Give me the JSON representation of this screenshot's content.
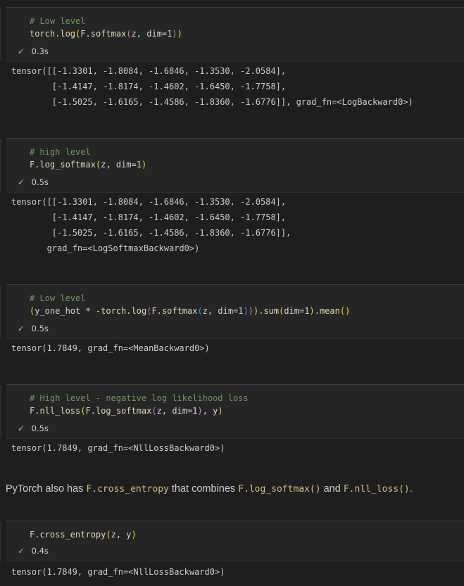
{
  "cells": [
    {
      "comment": "# Low level",
      "code_line": "torch.log(F.softmax(z, dim=1))",
      "status": "0.3s",
      "output": [
        "tensor([[-1.3301, -1.8084, -1.6846, -1.3530, -2.0584],",
        "        [-1.4147, -1.8174, -1.4602, -1.6450, -1.7758],",
        "        [-1.5025, -1.6165, -1.4586, -1.8360, -1.6776]], grad_fn=<LogBackward0>)"
      ]
    },
    {
      "comment": "# high level",
      "code_line": "F.log_softmax(z, dim=1)",
      "status": "0.5s",
      "output": [
        "tensor([[-1.3301, -1.8084, -1.6846, -1.3530, -2.0584],",
        "        [-1.4147, -1.8174, -1.4602, -1.6450, -1.7758],",
        "        [-1.5025, -1.6165, -1.4586, -1.8360, -1.6776]],",
        "       grad_fn=<LogSoftmaxBackward0>)"
      ]
    },
    {
      "comment": "# Low level",
      "code_line": "(y_one_hot * -torch.log(F.softmax(z, dim=1))).sum(dim=1).mean()",
      "status": "0.5s",
      "output": [
        "tensor(1.7849, grad_fn=<MeanBackward0>)"
      ]
    },
    {
      "comment": "# High level - negative log likelihood loss",
      "code_line": "F.nll_loss(F.log_softmax(z, dim=1), y)",
      "status": "0.5s",
      "output": [
        "tensor(1.7849, grad_fn=<NllLossBackward0>)"
      ]
    },
    {
      "comment": "",
      "code_line": "F.cross_entropy(z, y)",
      "status": "0.4s",
      "output": [
        "tensor(1.7849, grad_fn=<NllLossBackward0>)"
      ]
    }
  ],
  "markdown": {
    "text_1": "PyTorch also has ",
    "code_1": "F.cross_entropy",
    "text_2": " that combines ",
    "code_2": "F.log_softmax()",
    "text_3": " and ",
    "code_3": "F.nll_loss()",
    "text_4": "."
  },
  "status_check_icon": "check-icon",
  "colors": {
    "background": "#1e1e1e",
    "cell_background": "#252526",
    "comment": "#6a9955",
    "function": "#dcdcaa",
    "success": "#89d185",
    "inline_code": "#d7ba7d"
  }
}
